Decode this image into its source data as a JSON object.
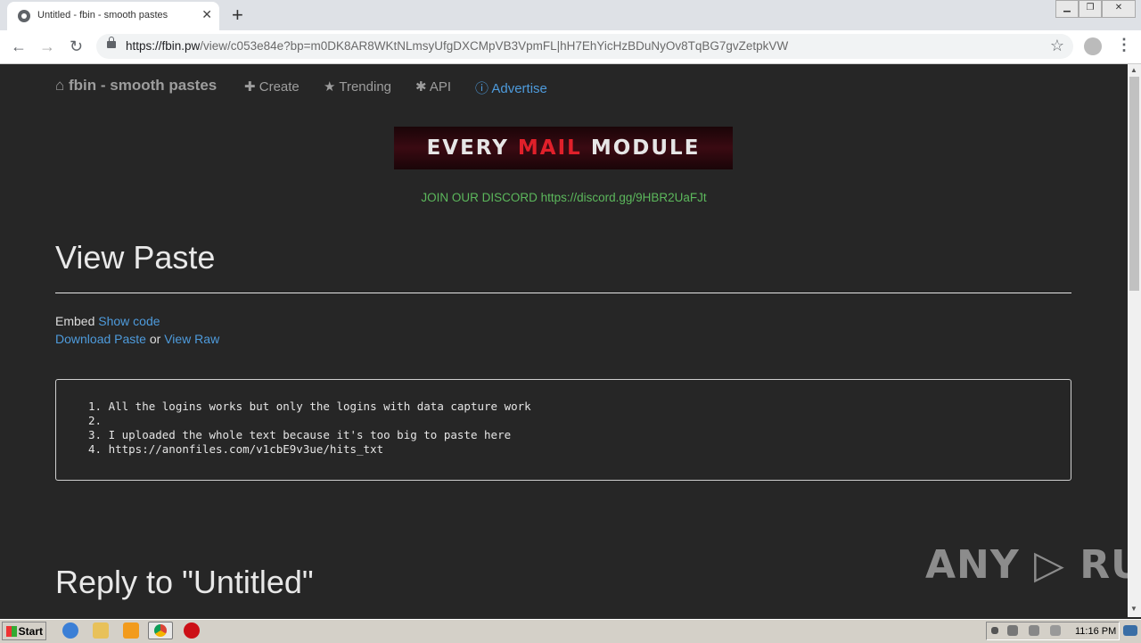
{
  "browser": {
    "tab_title": "Untitled - fbin - smooth pastes",
    "tab_close": "✕",
    "new_tab": "+",
    "url_host": "https://fbin.pw",
    "url_path": "/view/c053e84e?bp=m0DK8AR8WKtNLmsyUfgDXCMpVB3VpmFL|hH7EhYicHzBDuNyOv8TqBG7gvZetpkVW",
    "back_icon": "←",
    "forward_icon": "→",
    "reload_icon": "↻",
    "star_icon": "☆",
    "menu_icon": "⋮",
    "win_min": "▁",
    "win_max": "❐",
    "win_close": "✕"
  },
  "nav": {
    "brand": "fbin - smooth pastes",
    "brand_icon": "⌂",
    "create": "Create",
    "create_icon": "✚",
    "trending": "Trending",
    "trending_icon": "★",
    "api": "API",
    "api_icon": "✱",
    "advertise": "Advertise",
    "advertise_icon": "ⓘ"
  },
  "banner": {
    "word1": "E",
    "word1b": "VERY ",
    "word2": "MAIL",
    "word3": " MODULE"
  },
  "discord": "JOIN OUR DISCORD https://discord.gg/9HBR2UaFJt",
  "main": {
    "title": "View Paste",
    "embed_label": "Embed",
    "show_code": "Show code",
    "download": "Download Paste",
    "or": "or",
    "view_raw": "View Raw",
    "lines": [
      "1. All the logins works but only the logins with data capture work",
      "2.",
      "3. I uploaded the whole text because it's too big to paste here",
      "4. https://anonfiles.com/v1cbE9v3ue/hits_txt"
    ],
    "reply_title": "Reply to \"Untitled\""
  },
  "watermark": "ANY ▷ RUN",
  "taskbar": {
    "start": "Start",
    "clock": "11:16 PM"
  }
}
